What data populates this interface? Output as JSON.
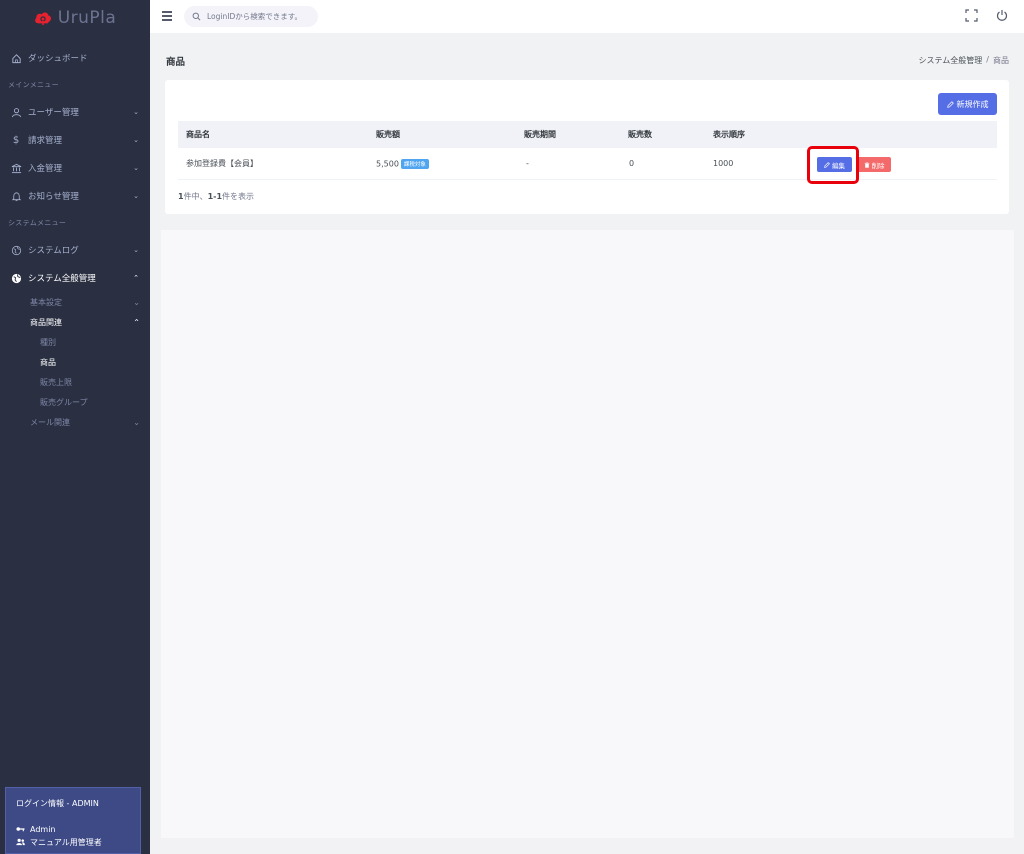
{
  "brand": {
    "name": "UruPla",
    "logo_color": "#e8212f"
  },
  "sidebar": {
    "dashboard": "ダッシュボード",
    "main_menu_title": "メインメニュー",
    "main_items": [
      {
        "label": "ユーザー管理",
        "icon": "user-icon"
      },
      {
        "label": "請求管理",
        "icon": "dollar-icon"
      },
      {
        "label": "入金管理",
        "icon": "bank-icon"
      },
      {
        "label": "お知らせ管理",
        "icon": "bell-icon"
      }
    ],
    "system_menu_title": "システムメニュー",
    "system_log": "システムログ",
    "system_admin": "システム全般管理",
    "sub": {
      "basic": "基本設定",
      "product_related": "商品関連",
      "type": "種別",
      "product": "商品",
      "sales_limit": "販売上限",
      "sales_group": "販売グループ",
      "mail_related": "メール関連"
    }
  },
  "login": {
    "title": "ログイン情報 - ADMIN",
    "user": "Admin",
    "role": "マニュアル用管理者"
  },
  "topbar": {
    "search_placeholder": "LoginIDから検索できます。"
  },
  "page": {
    "title": "商品",
    "breadcrumb": [
      "システム全般管理",
      "商品"
    ]
  },
  "toolbar": {
    "new_label": "新規作成"
  },
  "table": {
    "headers": [
      "商品名",
      "販売額",
      "販売期間",
      "販売数",
      "表示順序"
    ],
    "rows": [
      {
        "name": "参加登録費【会員】",
        "price": "5,500",
        "tax_badge": "課税対象",
        "period": "-",
        "count": "0",
        "order": "1000",
        "edit_label": "編集",
        "delete_label": "削除"
      }
    ]
  },
  "summary": {
    "total": "1",
    "mid": "件中、",
    "range": "1-1",
    "suffix": "件を表示"
  },
  "colors": {
    "primary": "#556ee6",
    "danger": "#f46a6a",
    "info": "#50a5f1",
    "sidebar": "#2a3042",
    "highlight": "#e8000b"
  }
}
